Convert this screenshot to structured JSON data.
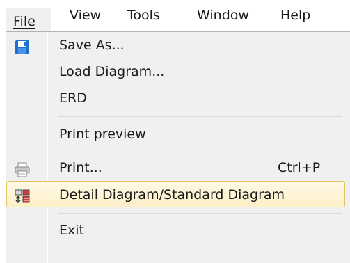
{
  "menubar": {
    "items": [
      {
        "label": "File",
        "active": true
      },
      {
        "label": "View"
      },
      {
        "label": "Tools"
      },
      {
        "label": "Window"
      },
      {
        "label": "Help"
      }
    ]
  },
  "file_menu": {
    "items": [
      {
        "label": "Save As...",
        "icon": "floppy-disk-icon",
        "shortcut": ""
      },
      {
        "label": "Load Diagram...",
        "icon": "",
        "shortcut": ""
      },
      {
        "label": "ERD",
        "icon": "",
        "shortcut": ""
      },
      {
        "label": "Print preview",
        "icon": "",
        "shortcut": ""
      },
      {
        "label": "Print...",
        "icon": "printer-icon",
        "shortcut": "Ctrl+P"
      },
      {
        "label": "Detail Diagram/Standard Diagram",
        "icon": "detail-diagram-icon",
        "shortcut": "",
        "highlighted": true
      },
      {
        "label": "Exit",
        "icon": "",
        "shortcut": ""
      }
    ]
  },
  "colors": {
    "highlight_border": "#e5c365",
    "highlight_fill": "#fdf0c8",
    "menu_background": "#f0f0f0"
  }
}
